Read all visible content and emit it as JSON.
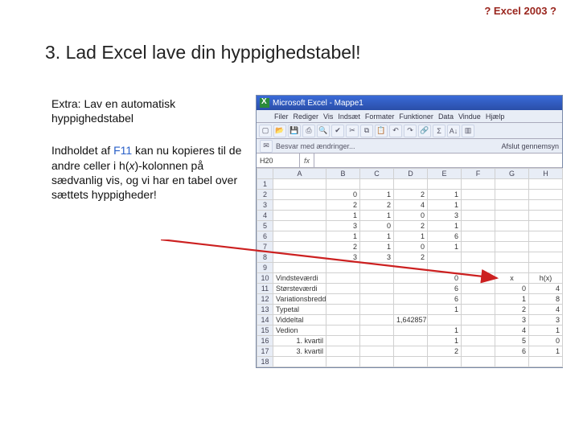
{
  "top_link": "? Excel 2003 ?",
  "heading": "3. Lad Excel lave din hyppighedstabel!",
  "para1_a": "Extra: Lav en automatisk hyppighedstabel",
  "para2_a": "Indholdet af ",
  "para2_f11": "F11",
  "para2_b": " kan nu kopieres til de andre celler i h(",
  "para2_x": "x",
  "para2_c": ")-kolonnen på sædvanlig vis, og vi har en tabel over sættets hyppigheder!",
  "excel": {
    "title": "Microsoft Excel - Mappe1",
    "menus": [
      "Filer",
      "Rediger",
      "Vis",
      "Indsæt",
      "Formater",
      "Funktioner",
      "Data",
      "Vindue",
      "Hjælp"
    ],
    "tb2_text": "Besvar med ændringer...",
    "tb2_close": "Afslut gennemsyn",
    "namebox": "H20",
    "cols": [
      "",
      "A",
      "B",
      "C",
      "D",
      "E",
      "F",
      "G",
      "H"
    ],
    "rows": [
      {
        "n": "1",
        "cells": [
          "",
          "",
          "",
          "",
          "",
          "",
          "",
          ""
        ]
      },
      {
        "n": "2",
        "cells": [
          "",
          "0",
          "1",
          "2",
          "1",
          "",
          "",
          ""
        ]
      },
      {
        "n": "3",
        "cells": [
          "",
          "2",
          "2",
          "4",
          "1",
          "",
          "",
          ""
        ]
      },
      {
        "n": "4",
        "cells": [
          "",
          "1",
          "1",
          "0",
          "3",
          "",
          "",
          ""
        ]
      },
      {
        "n": "5",
        "cells": [
          "",
          "3",
          "0",
          "2",
          "1",
          "",
          "",
          ""
        ]
      },
      {
        "n": "6",
        "cells": [
          "",
          "1",
          "1",
          "1",
          "6",
          "",
          "",
          ""
        ]
      },
      {
        "n": "7",
        "cells": [
          "",
          "2",
          "1",
          "0",
          "1",
          "",
          "",
          ""
        ]
      },
      {
        "n": "8",
        "cells": [
          "",
          "3",
          "3",
          "2",
          "",
          "",
          "",
          ""
        ]
      },
      {
        "n": "9",
        "cells": [
          "",
          "",
          "",
          "",
          "",
          "",
          "",
          ""
        ]
      },
      {
        "n": "10",
        "cells": [
          "Vindsteværdi",
          "",
          "",
          "",
          "0",
          "",
          "x",
          "h(x)"
        ]
      },
      {
        "n": "11",
        "cells": [
          "Størsteværdi",
          "",
          "",
          "",
          "6",
          "",
          "0",
          "4"
        ]
      },
      {
        "n": "12",
        "cells": [
          "Variationsbredde",
          "",
          "",
          "",
          "6",
          "",
          "1",
          "8"
        ]
      },
      {
        "n": "13",
        "cells": [
          "Typetal",
          "",
          "",
          "",
          "1",
          "",
          "2",
          "4"
        ]
      },
      {
        "n": "14",
        "cells": [
          "Viddeltal",
          "",
          "",
          "1,642857",
          "",
          "",
          "3",
          "3"
        ]
      },
      {
        "n": "15",
        "cells": [
          "Vedion",
          "",
          "",
          "",
          "1",
          "",
          "4",
          "1"
        ]
      },
      {
        "n": "16",
        "cells": [
          "1. kvartil",
          "",
          "",
          "",
          "1",
          "",
          "5",
          "0"
        ]
      },
      {
        "n": "17",
        "cells": [
          "3. kvartil",
          "",
          "",
          "",
          "2",
          "",
          "6",
          "1"
        ]
      },
      {
        "n": "18",
        "cells": [
          "",
          "",
          "",
          "",
          "",
          "",
          "",
          ""
        ]
      }
    ]
  }
}
